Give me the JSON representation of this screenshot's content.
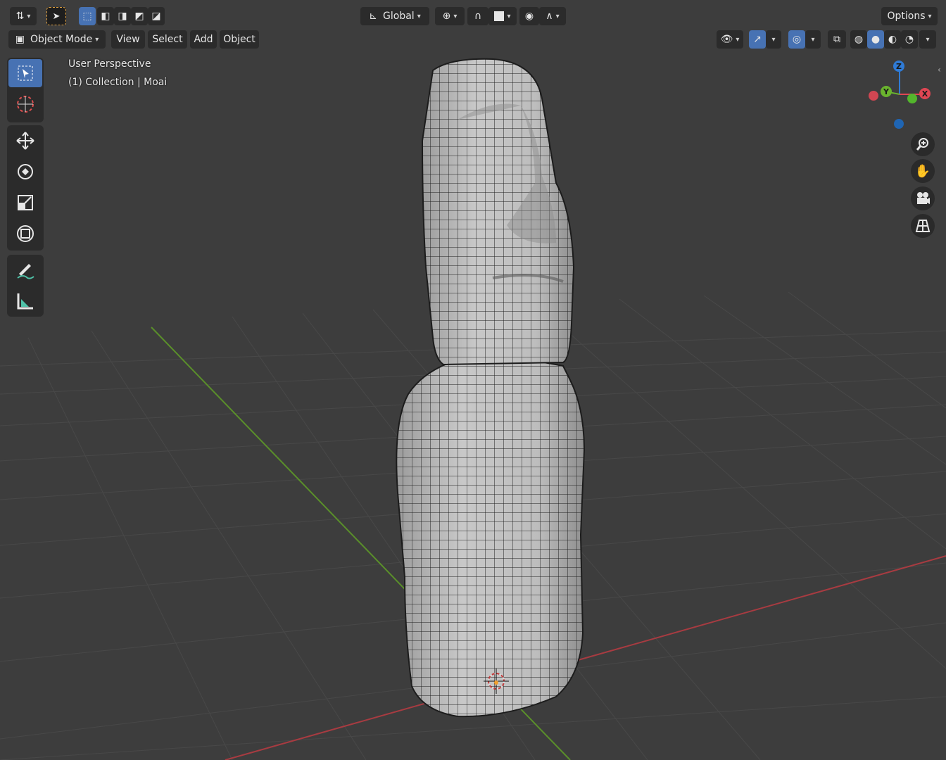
{
  "header": {
    "transform_orientation": "Global",
    "options_label": "Options"
  },
  "menubar": {
    "mode_label": "Object Mode",
    "items": [
      "View",
      "Select",
      "Add",
      "Object"
    ]
  },
  "viewport": {
    "view_name": "User Perspective",
    "collection_info": "(1) Collection | Moai"
  },
  "gizmo": {
    "axes": [
      "Z",
      "Y",
      "X"
    ]
  },
  "colors": {
    "accent": "#4772b3",
    "x_axis": "#e04653",
    "y_axis": "#6ab42e",
    "z_axis": "#2f7bd6",
    "mesh": "#b9b9b9"
  },
  "icons": {
    "toolbar": [
      "select-box-icon",
      "cursor-icon",
      "move-icon",
      "rotate-icon",
      "scale-icon",
      "transform-icon",
      "annotate-icon",
      "measure-icon"
    ],
    "navigation": [
      "zoom-icon",
      "pan-hand-icon",
      "camera-icon",
      "grid-view-icon"
    ]
  }
}
